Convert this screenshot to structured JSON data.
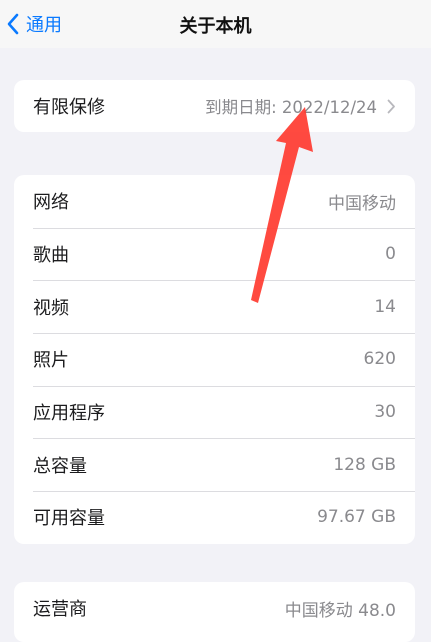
{
  "nav": {
    "back_label": "通用",
    "title": "关于本机"
  },
  "warranty": {
    "label": "有限保修",
    "value": "到期日期: 2022/12/24"
  },
  "info_rows": [
    {
      "label": "网络",
      "value": "中国移动"
    },
    {
      "label": "歌曲",
      "value": "0"
    },
    {
      "label": "视频",
      "value": "14"
    },
    {
      "label": "照片",
      "value": "620"
    },
    {
      "label": "应用程序",
      "value": "30"
    },
    {
      "label": "总容量",
      "value": "128 GB"
    },
    {
      "label": "可用容量",
      "value": "97.67 GB"
    }
  ],
  "carrier": {
    "label": "运营商",
    "value": "中国移动 48.0"
  },
  "colors": {
    "background": "#f2f2f7",
    "accent": "#0a7aff",
    "annotation_arrow": "#ff3b30"
  },
  "icons": [
    "chevron-left-icon",
    "chevron-right-icon",
    "annotation-arrow-icon"
  ]
}
